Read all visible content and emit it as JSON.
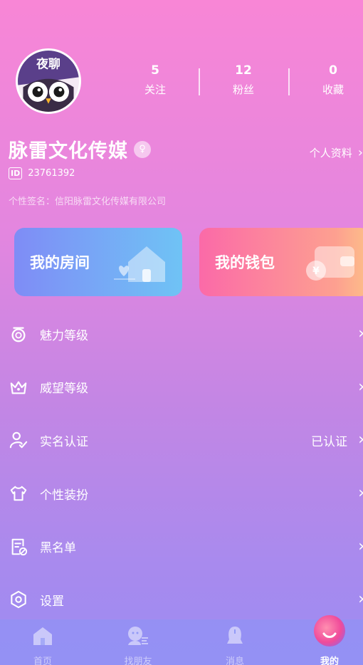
{
  "profile": {
    "avatar_text": "夜聊",
    "username": "脉雷文化传媒",
    "gender_symbol": "♀",
    "profile_link": "个人资料",
    "id_tag": "ID",
    "id_number": "23761392",
    "signature": "个性签名：信阳脉雷文化传媒有限公司"
  },
  "stats": [
    {
      "value": "5",
      "label": "关注"
    },
    {
      "value": "12",
      "label": "粉丝"
    },
    {
      "value": "0",
      "label": "收藏"
    }
  ],
  "cards": {
    "room": "我的房间",
    "wallet": "我的钱包"
  },
  "menu": [
    {
      "label": "魅力等级",
      "value": "",
      "icon": "charm-level-icon"
    },
    {
      "label": "威望等级",
      "value": "",
      "icon": "crown-icon"
    },
    {
      "label": "实名认证",
      "value": "已认证",
      "icon": "user-verify-icon"
    },
    {
      "label": "个性装扮",
      "value": "",
      "icon": "tshirt-icon"
    },
    {
      "label": "黑名单",
      "value": "",
      "icon": "blacklist-icon"
    },
    {
      "label": "设置",
      "value": "",
      "icon": "settings-icon"
    }
  ],
  "nav": [
    {
      "label": "首页",
      "icon": "home-icon"
    },
    {
      "label": "找朋友",
      "icon": "find-friends-icon"
    },
    {
      "label": "消息",
      "icon": "message-icon"
    },
    {
      "label": "我的",
      "icon": "profile-icon"
    }
  ],
  "colors": {
    "gradient_top": "#f886d6",
    "gradient_bottom": "#9c8cf2",
    "room_card": "#7f8cf6",
    "wallet_card": "#fb6aa8"
  }
}
